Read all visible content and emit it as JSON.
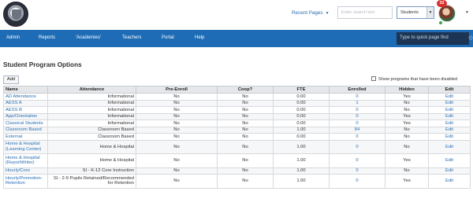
{
  "header": {
    "recent_pages_label": "Recent Pages",
    "search_placeholder": "Enter search text",
    "scope_value": "Students",
    "notification_count": "32"
  },
  "nav": {
    "items": [
      "Admin",
      "Reports",
      "'Academies'",
      "Teachers",
      "Portal",
      "Help"
    ],
    "quick_find_placeholder": "Type to quick page find"
  },
  "page": {
    "title": "Student Program Options",
    "add_label": "Add",
    "show_disabled_label": "Show programs that have been disabled"
  },
  "table": {
    "columns": [
      "Name",
      "Attendance",
      "Pre-Enroll",
      "Coop?",
      "FTE",
      "Enrolled",
      "Hidden",
      "Edit"
    ],
    "rows": [
      {
        "name": "AD Attendance",
        "attendance": "Informational",
        "pre_enroll": "No",
        "coop": "No",
        "fte": "0.00",
        "enrolled": "0",
        "hidden": "Yes",
        "edit": "Edit"
      },
      {
        "name": "AESS A",
        "attendance": "Informational",
        "pre_enroll": "No",
        "coop": "No",
        "fte": "0.00",
        "enrolled": "1",
        "hidden": "No",
        "edit": "Edit"
      },
      {
        "name": "AESS B",
        "attendance": "Informational",
        "pre_enroll": "No",
        "coop": "No",
        "fte": "0.00",
        "enrolled": "0",
        "hidden": "No",
        "edit": "Edit"
      },
      {
        "name": "App/Orientation",
        "attendance": "Informational",
        "pre_enroll": "No",
        "coop": "No",
        "fte": "0.00",
        "enrolled": "0",
        "hidden": "Yes",
        "edit": "Edit"
      },
      {
        "name": "Classical Students",
        "attendance": "Informational",
        "pre_enroll": "No",
        "coop": "No",
        "fte": "0.00",
        "enrolled": "0",
        "hidden": "Yes",
        "edit": "Edit"
      },
      {
        "name": "Classroom Based",
        "attendance": "Classroom Based",
        "pre_enroll": "No",
        "coop": "No",
        "fte": "1.00",
        "enrolled": "84",
        "hidden": "No",
        "edit": "Edit"
      },
      {
        "name": "External",
        "attendance": "Classroom Based",
        "pre_enroll": "No",
        "coop": "No",
        "fte": "0.00",
        "enrolled": "0",
        "hidden": "No",
        "edit": "Edit"
      },
      {
        "name": "Home & Hospital (Learning Center)",
        "attendance": "Home & Hospital",
        "pre_enroll": "No",
        "coop": "No",
        "fte": "1.00",
        "enrolled": "0",
        "hidden": "No",
        "edit": "Edit",
        "tall": true
      },
      {
        "name": "Home & Hospital (ReportWriter)",
        "attendance": "Home & Hospital",
        "pre_enroll": "No",
        "coop": "No",
        "fte": "1.00",
        "enrolled": "0",
        "hidden": "Yes",
        "edit": "Edit",
        "tall": true
      },
      {
        "name": "Hourly/Core",
        "attendance": "SI - K-12 Core Instruction",
        "pre_enroll": "No",
        "coop": "No",
        "fte": "1.00",
        "enrolled": "0",
        "hidden": "No",
        "edit": "Edit"
      },
      {
        "name": "Hourly/Promotion-Retention",
        "attendance": "SI - 2-9 Pupils Retained/Recommended for Retention",
        "pre_enroll": "No",
        "coop": "No",
        "fte": "1.00",
        "enrolled": "0",
        "hidden": "Yes",
        "edit": "Edit",
        "tall": true
      }
    ]
  }
}
